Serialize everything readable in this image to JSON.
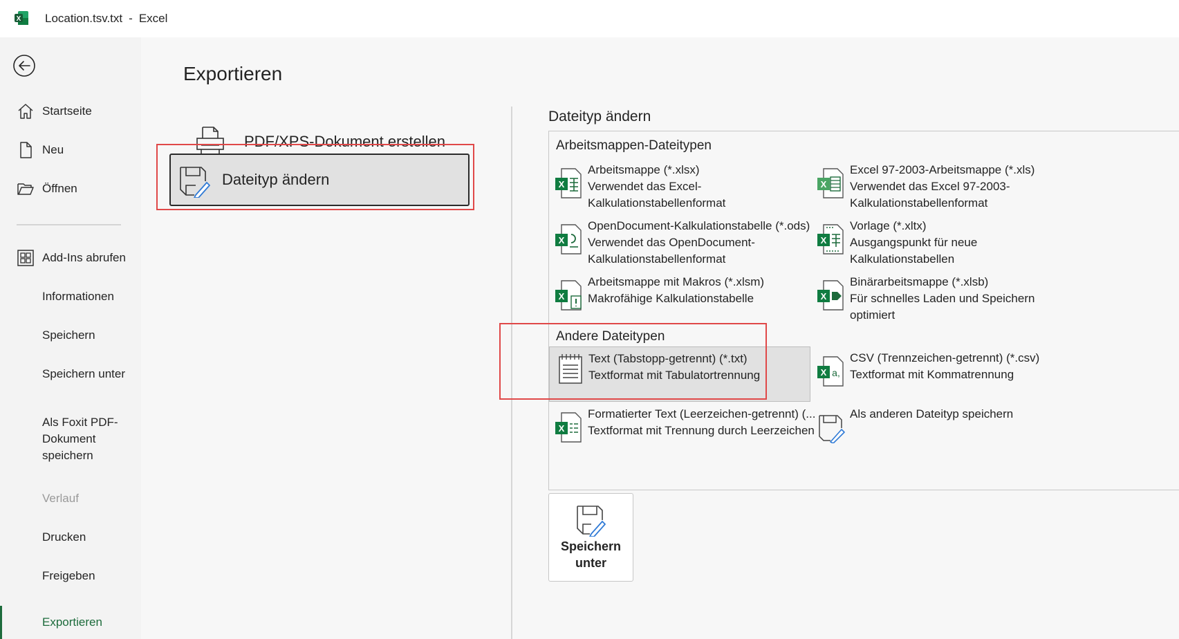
{
  "window": {
    "file_name": "Location.tsv.txt",
    "separator": "-",
    "app_name": "Excel"
  },
  "nav": {
    "items": [
      {
        "label": "Startseite",
        "icon": "home-icon"
      },
      {
        "label": "Neu",
        "icon": "new-document-icon"
      },
      {
        "label": "Öffnen",
        "icon": "open-folder-icon"
      },
      {
        "label": "Add-Ins abrufen",
        "icon": "add-ins-icon"
      },
      {
        "label": "Informationen"
      },
      {
        "label": "Speichern"
      },
      {
        "label": "Speichern unter"
      },
      {
        "label": "Als Foxit PDF-Dokument speichern",
        "lines": [
          "Als Foxit PDF-",
          "Dokument",
          "speichern"
        ]
      },
      {
        "label": "Verlauf",
        "disabled": true
      },
      {
        "label": "Drucken"
      },
      {
        "label": "Freigeben"
      },
      {
        "label": "Exportieren",
        "active": true
      }
    ]
  },
  "main": {
    "title": "Exportieren",
    "options": [
      {
        "label": "PDF/XPS-Dokument erstellen",
        "icon": "pdf-xps-icon"
      },
      {
        "label": "Dateityp ändern",
        "icon": "change-filetype-icon",
        "selected": true
      }
    ]
  },
  "filetypes": {
    "section_title": "Dateityp ändern",
    "workbook_header": "Arbeitsmappen-Dateitypen",
    "other_header": "Andere Dateitypen",
    "items": [
      {
        "name": "Arbeitsmappe (*.xlsx)",
        "desc": [
          "Verwendet das Excel-",
          "Kalkulationstabellenformat"
        ],
        "icon": "xlsx-icon"
      },
      {
        "name": "Excel 97-2003-Arbeitsmappe (*.xls)",
        "desc": [
          "Verwendet das Excel 97-2003-",
          "Kalkulationstabellenformat"
        ],
        "icon": "xls-icon"
      },
      {
        "name": "OpenDocument-Kalkulationstabelle (*.ods)",
        "desc": [
          "Verwendet das OpenDocument-",
          "Kalkulationstabellenformat"
        ],
        "icon": "ods-icon"
      },
      {
        "name": "Vorlage (*.xltx)",
        "desc": [
          "Ausgangspunkt für neue",
          "Kalkulationstabellen"
        ],
        "icon": "xltx-icon"
      },
      {
        "name": "Arbeitsmappe mit Makros (*.xlsm)",
        "desc": [
          "Makrofähige Kalkulationstabelle"
        ],
        "icon": "xlsm-icon"
      },
      {
        "name": "Binärarbeitsmappe (*.xlsb)",
        "desc": [
          "Für schnelles Laden und Speichern",
          "optimiert"
        ],
        "icon": "xlsb-icon"
      },
      {
        "name": "Text (Tabstopp-getrennt) (*.txt)",
        "desc": [
          "Textformat mit Tabulatortrennung"
        ],
        "icon": "txt-icon",
        "selected": true
      },
      {
        "name": "CSV (Trennzeichen-getrennt) (*.csv)",
        "desc": [
          "Textformat mit Kommatrennung"
        ],
        "icon": "csv-icon"
      },
      {
        "name": "Formatierter Text (Leerzeichen-getrennt) (...",
        "desc": [
          "Textformat mit Trennung durch Leerzeichen"
        ],
        "icon": "prn-icon"
      },
      {
        "name": "Als anderen Dateityp speichern",
        "desc": [],
        "icon": "other-filetype-icon"
      }
    ]
  },
  "save_as_button": {
    "lines": [
      "Speichern",
      "unter"
    ],
    "icon": "save-as-icon"
  },
  "colors": {
    "excel_green": "#1d6b3c",
    "highlight_red": "#e04848",
    "selected_bg": "#e1e1e1"
  }
}
